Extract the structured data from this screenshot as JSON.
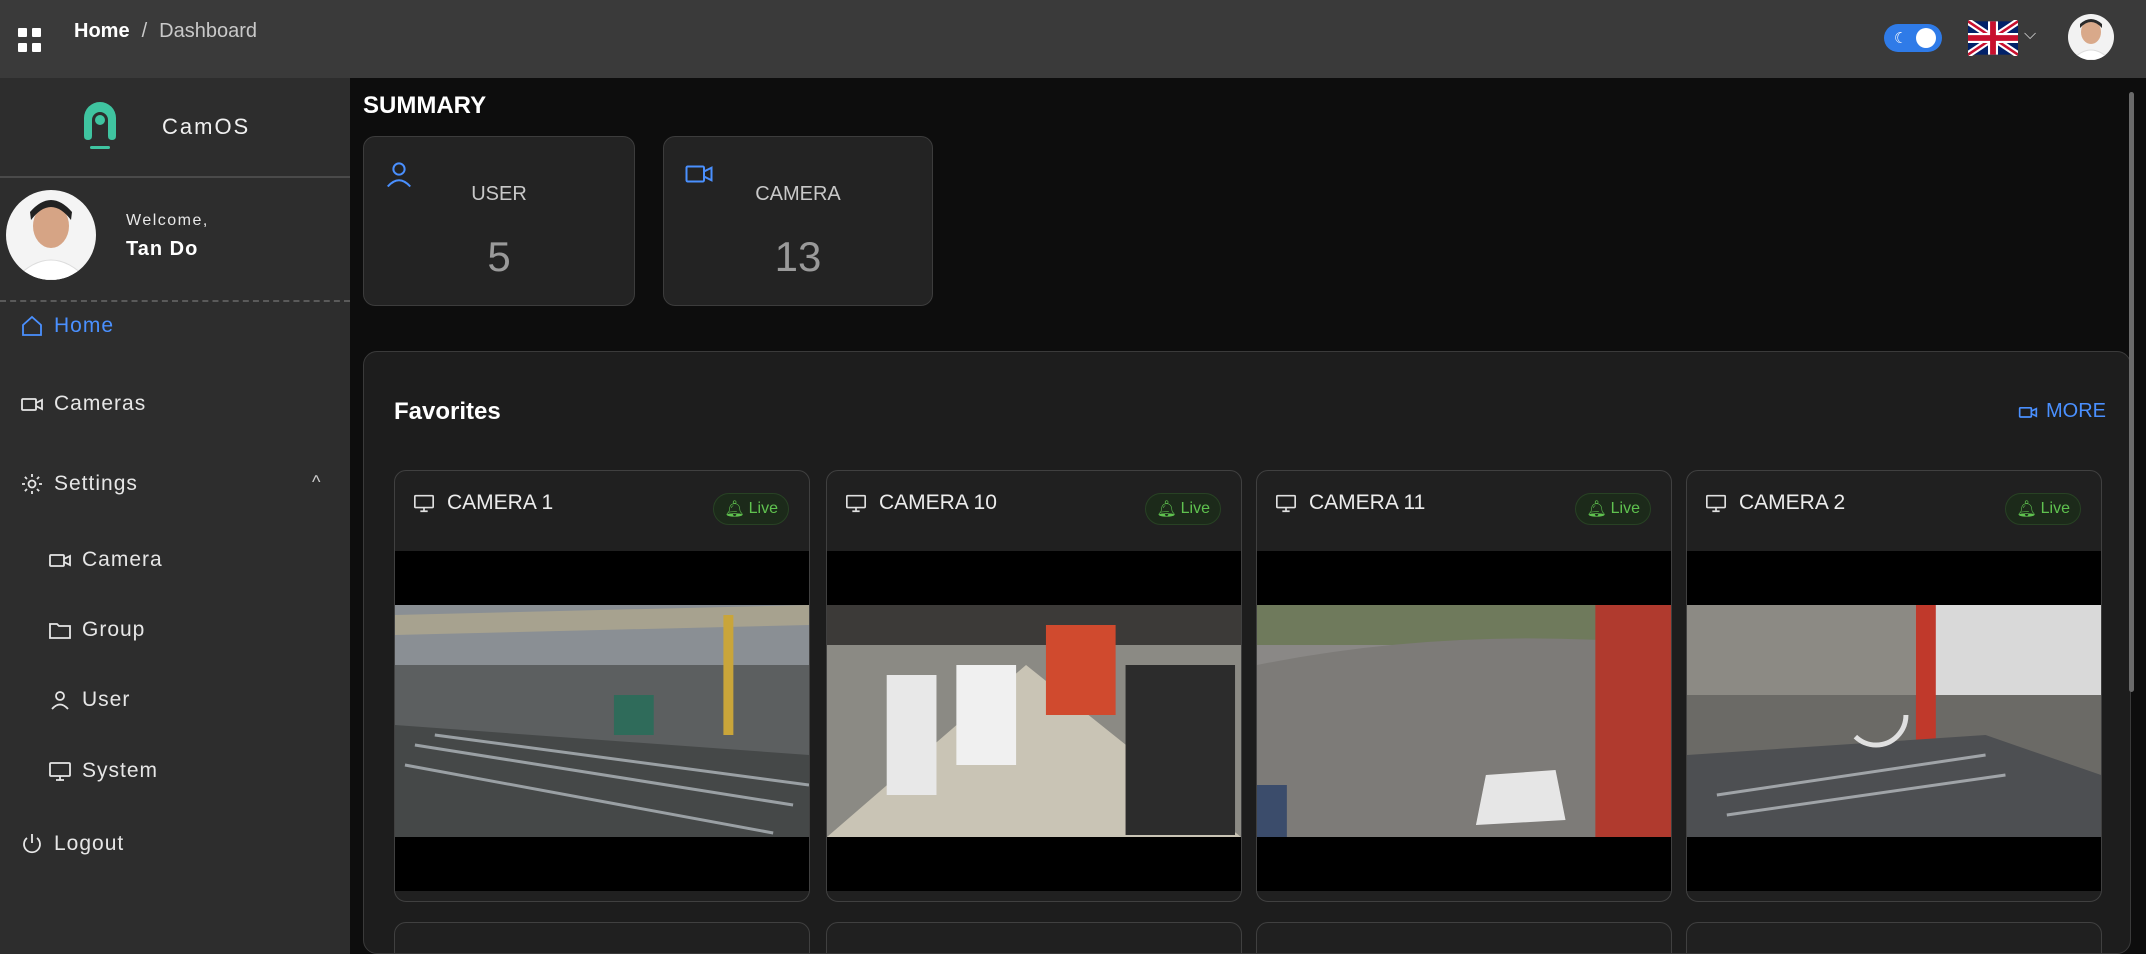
{
  "header": {
    "menu_icon": "grid-icon",
    "breadcrumb": {
      "home": "Home",
      "separator": "/",
      "current": "Dashboard"
    },
    "theme_toggle_icon": "moon-icon",
    "language_icon": "uk-flag-icon",
    "language_chevron": "⌵"
  },
  "sidebar": {
    "logo_text": "CamOS",
    "welcome": "Welcome,",
    "username": "Tan Do",
    "nav": [
      {
        "label": "Home",
        "icon": "home-icon"
      },
      {
        "label": "Cameras",
        "icon": "camera-icon"
      },
      {
        "label": "Settings",
        "icon": "gear-icon",
        "chevron": "^"
      },
      {
        "label": "Camera",
        "icon": "camera-icon"
      },
      {
        "label": "Group",
        "icon": "folder-icon"
      },
      {
        "label": "User",
        "icon": "user-icon"
      },
      {
        "label": "System",
        "icon": "monitor-icon"
      },
      {
        "label": "Logout",
        "icon": "power-icon"
      }
    ]
  },
  "main": {
    "summary_title": "SUMMARY",
    "stats": [
      {
        "label": "USER",
        "value": "5",
        "icon": "user-icon"
      },
      {
        "label": "CAMERA",
        "value": "13",
        "icon": "video-icon"
      }
    ],
    "favorites": {
      "title": "Favorites",
      "more_label": "MORE",
      "cameras": [
        {
          "name": "CAMERA 1",
          "status": "Live"
        },
        {
          "name": "CAMERA 10",
          "status": "Live"
        },
        {
          "name": "CAMERA 11",
          "status": "Live"
        },
        {
          "name": "CAMERA 2",
          "status": "Live"
        }
      ]
    }
  },
  "colors": {
    "accent": "#4a90ff",
    "live": "#5fc24f",
    "sidebar": "#2d2d2d",
    "main_bg": "#0d0d0d"
  }
}
